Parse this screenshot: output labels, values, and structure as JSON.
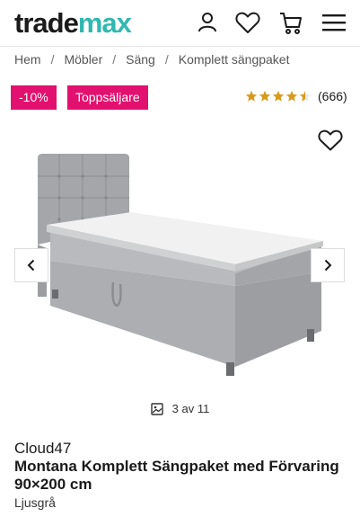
{
  "header": {
    "logo_part1": "trade",
    "logo_part2": "max",
    "brand_color": "#2fb8b0",
    "icons": [
      "account-icon",
      "wishlist-heart-icon",
      "cart-icon",
      "hamburger-menu-icon"
    ]
  },
  "breadcrumb": [
    "Hem",
    "Möbler",
    "Säng",
    "Komplett sängpaket"
  ],
  "badges": {
    "discount": "-10%",
    "bestseller": "Toppsäljare",
    "color": "#e2106e"
  },
  "rating": {
    "stars": 4.5,
    "count": "(666)",
    "star_color": "#d89a1c"
  },
  "gallery": {
    "counter": "3 av 11"
  },
  "product": {
    "brand": "Cloud47",
    "title": "Montana Komplett Sängpaket med Förvaring 90×200 cm",
    "variant": "Ljusgrå"
  }
}
